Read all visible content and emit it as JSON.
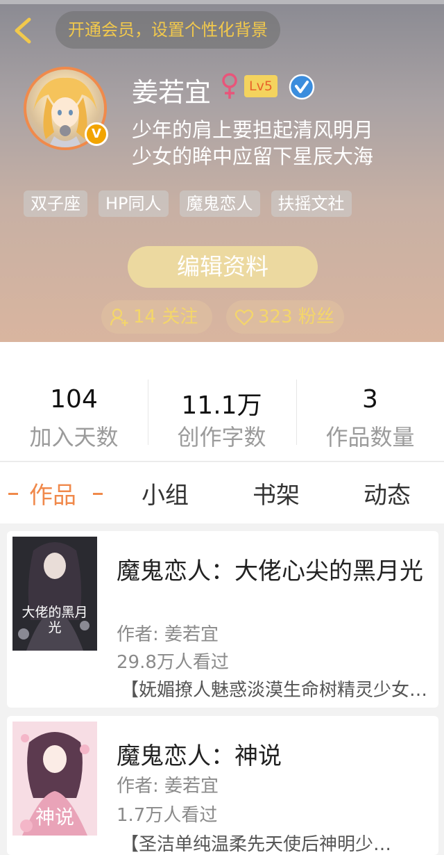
{
  "header": {
    "vip_banner": "开通会员，设置个性化背景",
    "username": "姜若宜",
    "gender_symbol": "♀",
    "level": "Lv5",
    "avatar_badge": "V",
    "bio_line1": "少年的肩上要担起清风明月",
    "bio_line2": "少女的眸中应留下星辰大海",
    "tags": [
      "双子座",
      "HP同人",
      "魔鬼恋人",
      "扶摇文社"
    ],
    "edit_label": "编辑资料",
    "follow_label": "14 关注",
    "fans_label": "323 粉丝"
  },
  "stats": [
    {
      "value": "104",
      "label": "加入天数"
    },
    {
      "value": "11.1万",
      "label": "创作字数"
    },
    {
      "value": "3",
      "label": "作品数量"
    }
  ],
  "tabs": [
    {
      "label": "作品",
      "active": true
    },
    {
      "label": "小组",
      "active": false
    },
    {
      "label": "书架",
      "active": false
    },
    {
      "label": "动态",
      "active": false
    }
  ],
  "books": [
    {
      "title": "魔鬼恋人：大佬心尖的黑月光",
      "author": "作者: 姜若宜",
      "views": "29.8万人看过",
      "desc": "【妩媚撩人魅惑淡漠生命树精灵少女…",
      "cover_text": "大佬的黑月光"
    },
    {
      "title": "魔鬼恋人：神说",
      "author": "作者: 姜若宜",
      "views": "1.7万人看过",
      "desc": "【圣洁单纯温柔先天使后神明少…",
      "cover_text": "神说"
    }
  ],
  "colors": {
    "accent": "#f0894b",
    "vip_text": "#f2c94c",
    "level_badge_bg": "#f4d35e",
    "verified": "#3b8ddd"
  },
  "icons": {
    "back": "chevron-left-icon",
    "gender": "female-icon",
    "verified": "verified-check-icon",
    "follow": "user-plus-icon",
    "fans": "heart-icon"
  }
}
